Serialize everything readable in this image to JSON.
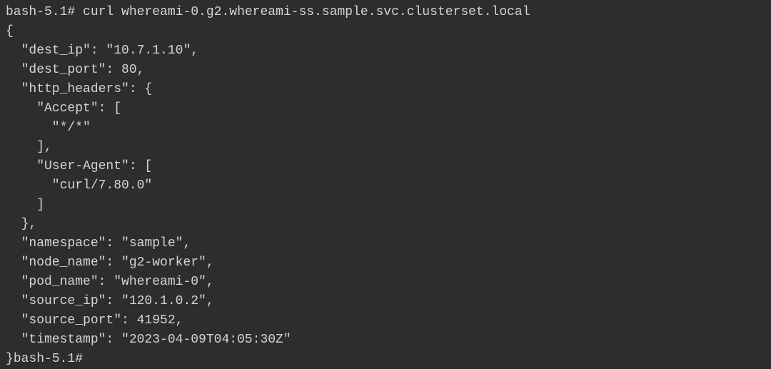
{
  "terminal": {
    "prompt1": "bash-5.1# ",
    "command": "curl whereami-0.g2.whereami-ss.sample.svc.clusterset.local",
    "line1": "{",
    "line2": "  \"dest_ip\": \"10.7.1.10\",",
    "line3": "  \"dest_port\": 80,",
    "line4": "  \"http_headers\": {",
    "line5": "    \"Accept\": [",
    "line6": "      \"*/*\"",
    "line7": "    ],",
    "line8": "    \"User-Agent\": [",
    "line9": "      \"curl/7.80.0\"",
    "line10": "    ]",
    "line11": "  },",
    "line12": "  \"namespace\": \"sample\",",
    "line13": "  \"node_name\": \"g2-worker\",",
    "line14": "  \"pod_name\": \"whereami-0\",",
    "line15": "  \"source_ip\": \"120.1.0.2\",",
    "line16": "  \"source_port\": 41952,",
    "line17": "  \"timestamp\": \"2023-04-09T04:05:30Z\"",
    "line18_prefix": "}",
    "prompt2": "bash-5.1#"
  }
}
